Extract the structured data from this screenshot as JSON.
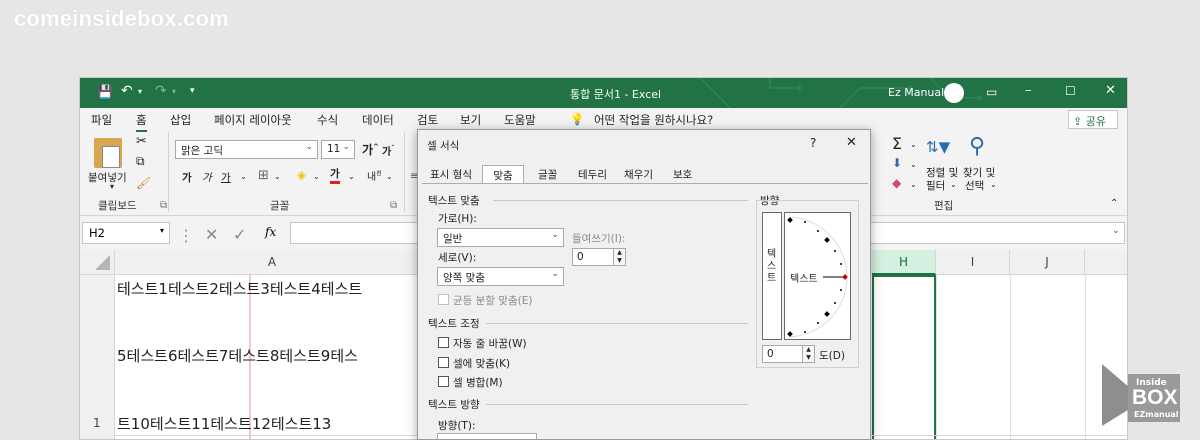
{
  "watermark": "comeinsidebox.com",
  "titlebar": {
    "doc_title": "통합 문서1  -  Excel",
    "user": "Ez Manual"
  },
  "menu": [
    "파일",
    "홈",
    "삽입",
    "페이지 레이아웃",
    "수식",
    "데이터",
    "검토",
    "보기",
    "도움말"
  ],
  "menu_search": "어떤 작업을 원하시나요?",
  "share_label": "공유",
  "ribbon": {
    "paste_label": "붙여넣기",
    "clipboard_label": "클립보드",
    "font_name": "맑은 고딕",
    "font_size": "11",
    "font_group_label": "글꼴",
    "edit_group_label": "편집",
    "sort_label": "정렬 및",
    "sort_label2": "필터",
    "find_label": "찾기 및",
    "find_label2": "선택"
  },
  "namebox": "H2",
  "fx": "fx",
  "columns": [
    "A",
    "H",
    "I",
    "J"
  ],
  "row_number": "1",
  "cell_lines": [
    "테스트1테스트2테스트3테스트4테스트",
    "5테스트6테스트7테스트8테스트9테스",
    "트10테스트11테스트12테스트13"
  ],
  "dialog": {
    "title": "셀 서식",
    "help": "?",
    "close": "✕",
    "tabs": [
      "표시 형식",
      "맞춤",
      "글꼴",
      "테두리",
      "채우기",
      "보호"
    ],
    "section_align": "텍스트 맞춤",
    "horizontal_label": "가로(H):",
    "horizontal_value": "일반",
    "indent_label": "들여쓰기(I):",
    "indent_value": "0",
    "vertical_label": "세로(V):",
    "vertical_value": "양쪽 맞춤",
    "distributed_label": "균등 분할 맞춤(E)",
    "section_control": "텍스트 조정",
    "wrap_label": "자동 줄 바꿈(W)",
    "shrink_label": "셀에 맞춤(K)",
    "merge_label": "셀 병합(M)",
    "section_direction": "텍스트 방향",
    "direction_label": "방향(T):",
    "orientation_title": "방향",
    "vertical_text": "텍스트",
    "dial_text": "텍스트",
    "degree_value": "0",
    "degree_label": "도(D)"
  },
  "badge": {
    "top": "Inside",
    "mid": "BOX",
    "bottom": "EZmanual"
  }
}
